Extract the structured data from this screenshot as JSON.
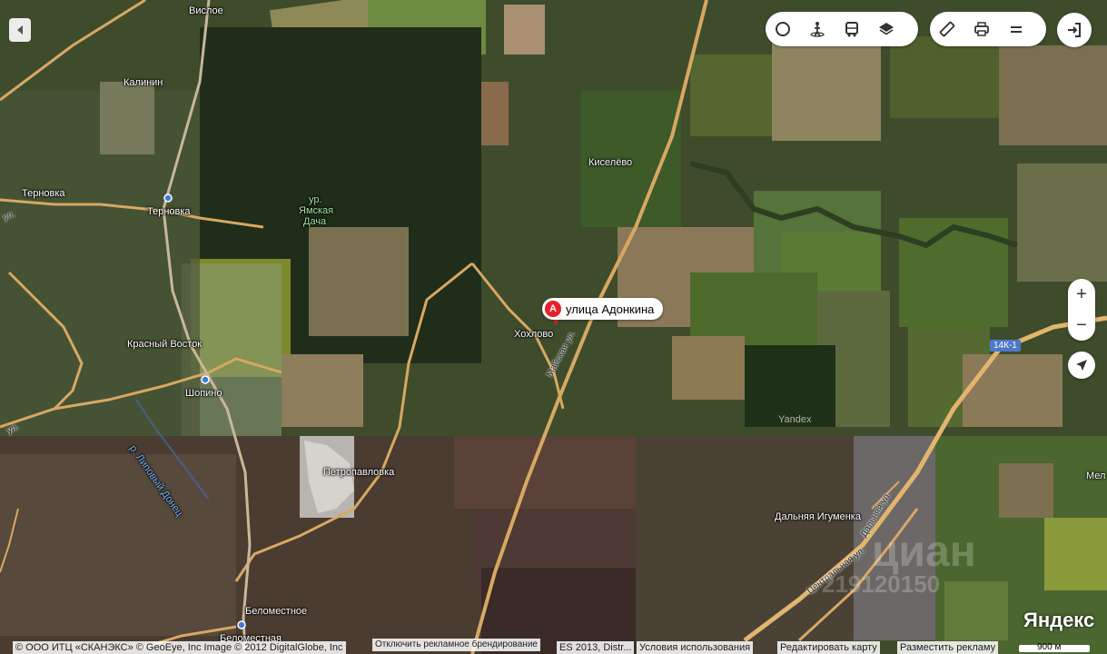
{
  "map": {
    "places": [
      {
        "id": "vislo",
        "text": "Вислое"
      },
      {
        "id": "kalinin",
        "text": "Калинин"
      },
      {
        "id": "ternovka1",
        "text": "Терновка"
      },
      {
        "id": "ternovka2",
        "text": "Терновка"
      },
      {
        "id": "yamskaya1",
        "text": "ур."
      },
      {
        "id": "yamskaya2",
        "text": "Ямская"
      },
      {
        "id": "yamskaya3",
        "text": "Дача"
      },
      {
        "id": "kiselevo",
        "text": "Киселёво"
      },
      {
        "id": "khokhlovo",
        "text": "Хохлово"
      },
      {
        "id": "krasny",
        "text": "Красный Восток"
      },
      {
        "id": "shopino",
        "text": "Шопино"
      },
      {
        "id": "petropavlovka",
        "text": "Петропавловка"
      },
      {
        "id": "dalnyaya",
        "text": "Дальняя Игуменка"
      },
      {
        "id": "belomestnoe",
        "text": "Беломестное"
      },
      {
        "id": "belomestnaya",
        "text": "Беломестная"
      },
      {
        "id": "river",
        "text": "р. Липовый Донец"
      },
      {
        "id": "yandex_wm",
        "text": "Yandex"
      },
      {
        "id": "mel",
        "text": "Мел"
      }
    ],
    "streets": [
      {
        "id": "maiskaya",
        "text": "Майская ул."
      },
      {
        "id": "centralnaya",
        "text": "Центральная ул."
      },
      {
        "id": "dalnyaya_ul",
        "text": "Дальняя ул."
      },
      {
        "id": "ul_left",
        "text": "ул."
      },
      {
        "id": "ul_left2",
        "text": "ул."
      }
    ],
    "road_shield": "14К-1",
    "watermark": "циан",
    "watermark_num": "219120150"
  },
  "marker": {
    "letter": "A",
    "label": "улица Адонкина"
  },
  "controls": {
    "zoom_in": "+",
    "zoom_out": "−"
  },
  "brand": "Яндекс",
  "scale": "900 м",
  "footer": {
    "copyright": "© ООО ИТЦ «СКАНЭКС» © GeoEye, Inc Image © 2012 DigitalGlobe, Inc",
    "disable_branding": "Отключить рекламное брендирование",
    "copyright_tail": "ES 2013, Distr...",
    "terms": "Условия использования",
    "edit_map": "Редактировать карту",
    "place_ad": "Разместить рекламу"
  }
}
